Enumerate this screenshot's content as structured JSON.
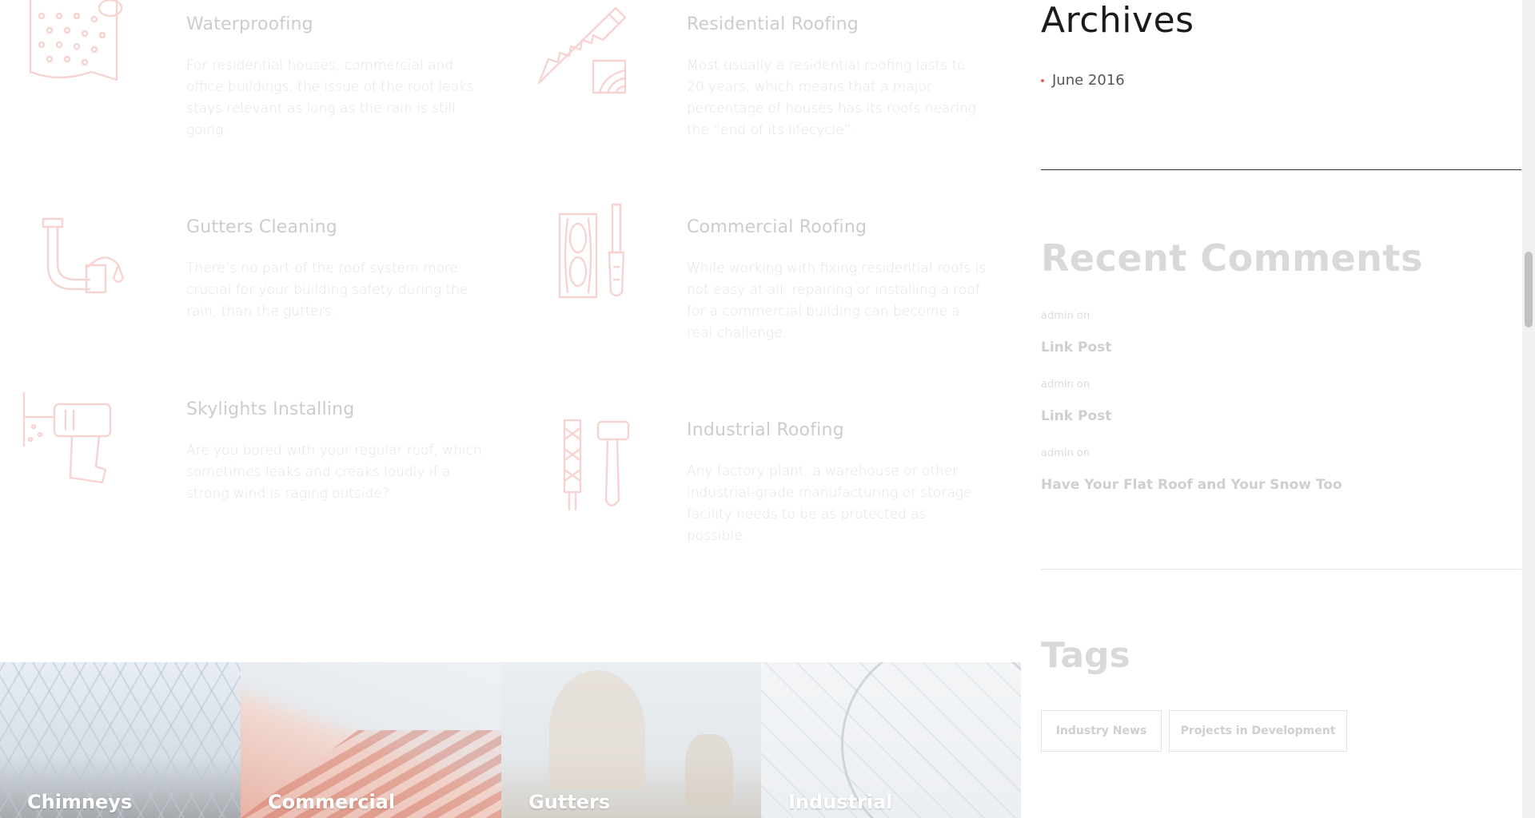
{
  "services": [
    {
      "title": "Waterproofing",
      "description": "For residential houses, commercial and office buildings, the issue of the roof leaks stays relevant as long as the rain is still going.",
      "icon": "waterproofing-roll-icon"
    },
    {
      "title": "Residential Roofing",
      "description": "Most usually a residential roofing lasts to 20 years, which means that a major percentage of houses has its roofs nearing the “end of its lifecycle”.",
      "icon": "saw-and-wood-icon"
    },
    {
      "title": "Gutters Cleaning",
      "description": "There’s no part of the roof system more crucial for your building safety during the rain, than the gutters.",
      "icon": "gutter-pipe-icon"
    },
    {
      "title": "Commercial Roofing",
      "description": "While working with fixing residential roofs is not easy at all, repairing or installing a roof for a commercial building can become a real challenge.",
      "icon": "wood-and-chisel-icon"
    },
    {
      "title": "Skylights Installing",
      "description": "Are you bored with your regular roof, which sometimes leaks and creaks loudly if a strong wind is raging outside?",
      "icon": "drill-icon"
    },
    {
      "title": "Industrial Roofing",
      "description": "Any factory plant, a warehouse or other industrial-grade manufacturing or storage facility needs to be as protected as possible.",
      "icon": "file-and-hammer-icon"
    }
  ],
  "gallery": [
    {
      "label": "Chimneys"
    },
    {
      "label": "Commercial"
    },
    {
      "label": "Gutters"
    },
    {
      "label": "Industrial"
    }
  ],
  "sidebar": {
    "archives": {
      "title": "Archives",
      "items": [
        "June 2016"
      ]
    },
    "recent_comments": {
      "title": "Recent Comments",
      "items": [
        {
          "meta": "admin on",
          "link": "Link Post"
        },
        {
          "meta": "admin on",
          "link": "Link Post"
        },
        {
          "meta": "admin on",
          "link": "Have Your Flat Roof and Your Snow Too"
        }
      ]
    },
    "tags": {
      "title": "Tags",
      "items": [
        "Industry News",
        "Projects in Development"
      ]
    }
  },
  "colors": {
    "accent": "#e3655b",
    "dark_text": "#1b1b1b",
    "muted_text": "#9a9a9a"
  }
}
